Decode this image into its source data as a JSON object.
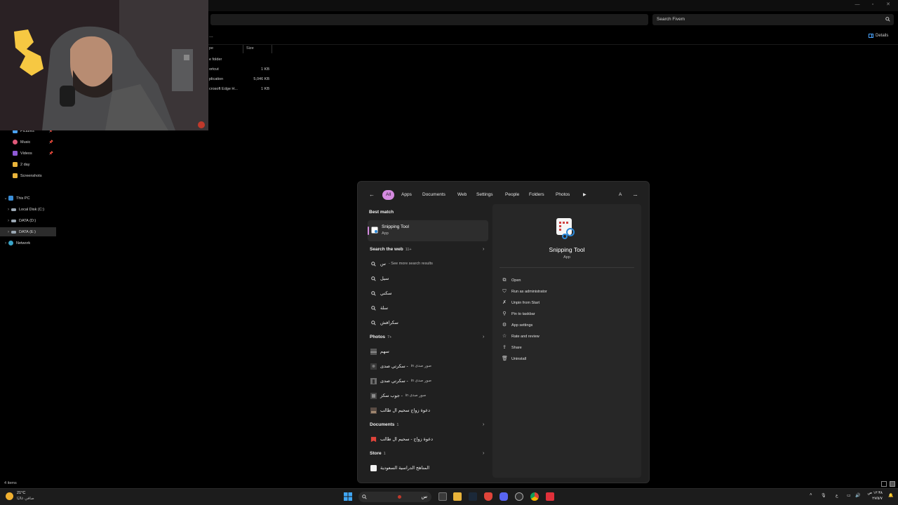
{
  "explorer": {
    "search_placeholder": "Search Fivem",
    "details_label": "Details",
    "columns": {
      "type": "pe",
      "size": "Size"
    },
    "files": [
      {
        "type": "e folder",
        "size": ""
      },
      {
        "type": "ortcut",
        "size": "1 KB"
      },
      {
        "type": "plication",
        "size": "5,046 KB"
      },
      {
        "type": "crosoft Edge H...",
        "size": "1 KB"
      }
    ],
    "sidebar": {
      "quick": [
        {
          "label": "Pictures",
          "icon": "pictures-icon",
          "color": "#4aa3ff"
        },
        {
          "label": "Music",
          "icon": "music-icon",
          "color": "#e0597a"
        },
        {
          "label": "Videos",
          "icon": "videos-icon",
          "color": "#8f5ad6"
        },
        {
          "label": "2 day",
          "icon": "folder-icon",
          "color": "#e8b33a"
        },
        {
          "label": "Screenshots",
          "icon": "folder-icon",
          "color": "#e8b33a"
        }
      ],
      "this_pc": "This PC",
      "drives": [
        "Local Disk (C:)",
        "DATA (D:)",
        "DATA (E:)"
      ],
      "network": "Network"
    },
    "status": "4 items"
  },
  "search_flyout": {
    "tabs": [
      "All",
      "Apps",
      "Documents",
      "Web",
      "Settings",
      "People",
      "Folders",
      "Photos"
    ],
    "avatar_letter": "A",
    "more": "...",
    "best_match_label": "Best match",
    "best_match": {
      "name": "Snipping Tool",
      "type": "App"
    },
    "web_section": {
      "label": "Search the web",
      "count": "11+"
    },
    "web_items": [
      {
        "query": "س",
        "suffix": "- See more search results"
      },
      {
        "query": "سيل",
        "suffix": ""
      },
      {
        "query": "سكني",
        "suffix": ""
      },
      {
        "query": "سلة",
        "suffix": ""
      },
      {
        "query": "سكرافش",
        "suffix": ""
      }
    ],
    "photos_section": {
      "label": "Photos",
      "count": "7+"
    },
    "photo_items": [
      {
        "name": "سهم",
        "location": ""
      },
      {
        "name": "سكرتي صدى -",
        "location": "in صور صدى"
      },
      {
        "name": "سكرتي صدى -",
        "location": "in صور صدى"
      },
      {
        "name": "جوب سكز -",
        "location": "in صور صدى"
      },
      {
        "name": "دعوة زواج سحيم ال طالب",
        "location": ""
      }
    ],
    "documents_section": {
      "label": "Documents",
      "count": "1"
    },
    "document_items": [
      {
        "name": "دعوة زواج - سحيم ال طالب"
      }
    ],
    "store_section": {
      "label": "Store",
      "count": "1"
    },
    "store_items": [
      {
        "name": "المناهج الدراسية السعودية"
      }
    ],
    "preview": {
      "name": "Snipping Tool",
      "type": "App",
      "actions": [
        "Open",
        "Run as administrator",
        "Unpin from Start",
        "Pin to taskbar",
        "App settings",
        "Rate and review",
        "Share",
        "Uninstall"
      ]
    }
  },
  "taskbar": {
    "weather": {
      "temp": "21°C",
      "desc": "صافي غالبًا"
    },
    "search_text": "س",
    "lang": "ع",
    "time": "١٢:٣٨ ص",
    "date": "٢٧/٥/٧"
  }
}
